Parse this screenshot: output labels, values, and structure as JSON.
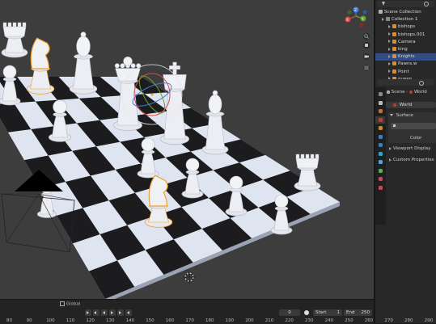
{
  "outliner": {
    "root": "Scene Collection",
    "items": [
      {
        "label": "Collection 1",
        "color": "#888888",
        "selected": false
      },
      {
        "label": "bishops",
        "color": "#d98a3a",
        "selected": false
      },
      {
        "label": "bishops.001",
        "color": "#d98a3a",
        "selected": false
      },
      {
        "label": "Camera",
        "color": "#d98a3a",
        "selected": false
      },
      {
        "label": "king",
        "color": "#d98a3a",
        "selected": false
      },
      {
        "label": "Knights",
        "color": "#d98a3a",
        "selected": true
      },
      {
        "label": "Pawns.w",
        "color": "#d98a3a",
        "selected": false
      },
      {
        "label": "Point",
        "color": "#d98a3a",
        "selected": false
      },
      {
        "label": "queen",
        "color": "#d98a3a",
        "selected": false
      }
    ]
  },
  "properties": {
    "breadcrumb_scene": "Scene",
    "breadcrumb_world": "World",
    "world_name": "World",
    "surface_label": "Surface",
    "color_label": "Color",
    "viewport_display": "Viewport Display",
    "custom_properties": "Custom Properties"
  },
  "gizmo": {
    "z": "Z",
    "y": "Y",
    "x": "X"
  },
  "timeline": {
    "transform": "Global",
    "current_frame": "0",
    "start_label": "Start",
    "start": "1",
    "end_label": "End",
    "end": "250",
    "ruler": [
      "80",
      "90",
      "100",
      "110",
      "120",
      "130",
      "140",
      "150",
      "160",
      "170",
      "180",
      "190",
      "200",
      "210",
      "220",
      "230",
      "240",
      "250",
      "260",
      "270",
      "280",
      "290"
    ]
  },
  "colors": {
    "viewport": "#3d3d3d",
    "selection": "#f0a030",
    "board_light": "#dfe5f0",
    "board_dark": "#1c1c1e",
    "active_row": "#334d80"
  },
  "icons": [
    "filter-icon",
    "search-icon",
    "tool-icon",
    "scene-icon",
    "world-icon",
    "object-icon",
    "modifier-icon",
    "particles-icon",
    "physics-icon",
    "constraints-icon",
    "data-icon",
    "material-icon",
    "play-icon",
    "zoom-icon",
    "hand-icon",
    "camera-view-icon",
    "grid-icon"
  ]
}
